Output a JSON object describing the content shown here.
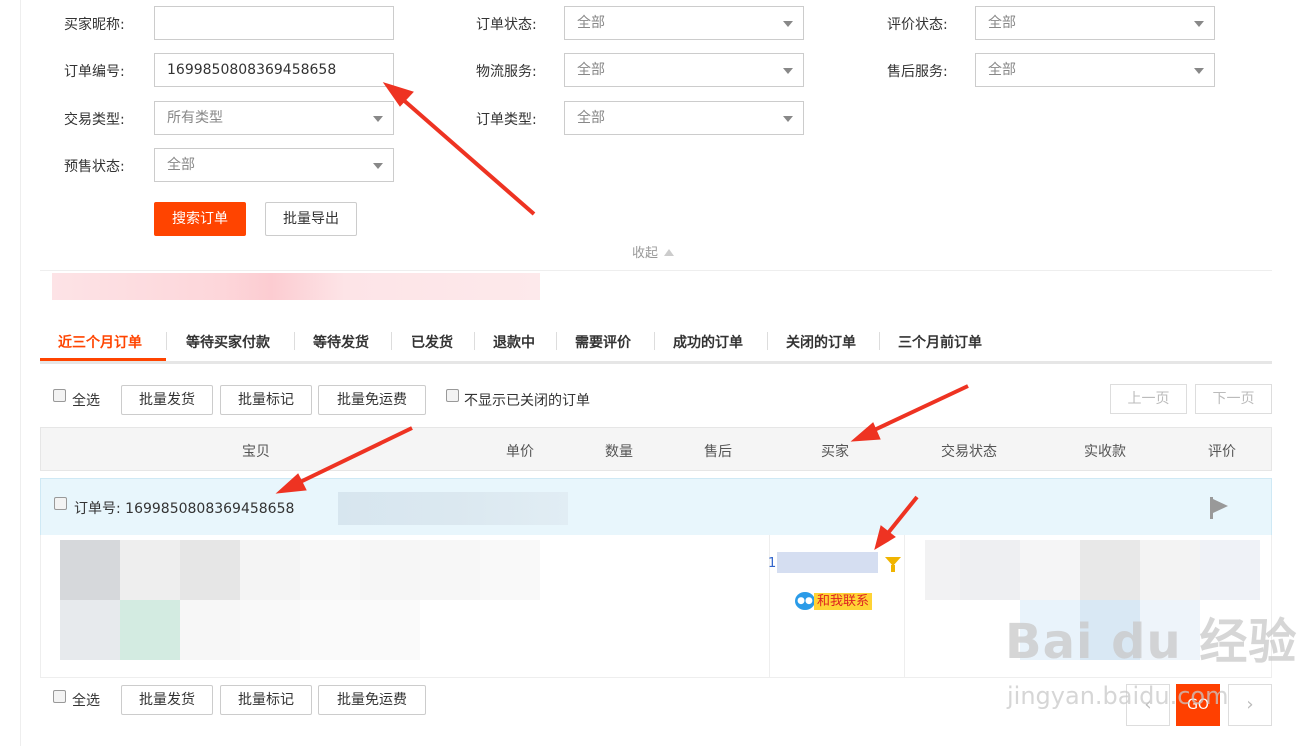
{
  "search_form": {
    "buyer_nickname": {
      "label": "买家昵称:",
      "value": ""
    },
    "order_number": {
      "label": "订单编号:",
      "value": "1699850808369458658"
    },
    "trade_type": {
      "label": "交易类型:",
      "value": "所有类型"
    },
    "presale_status": {
      "label": "预售状态:",
      "value": "全部"
    },
    "order_status": {
      "label": "订单状态:",
      "value": "全部"
    },
    "logistics_service": {
      "label": "物流服务:",
      "value": "全部"
    },
    "order_type": {
      "label": "订单类型:",
      "value": "全部"
    },
    "review_status": {
      "label": "评价状态:",
      "value": "全部"
    },
    "aftersale_service": {
      "label": "售后服务:",
      "value": "全部"
    },
    "search_button": "搜索订单",
    "export_button": "批量导出",
    "collapse_label": "收起"
  },
  "tabs": [
    "近三个月订单",
    "等待买家付款",
    "等待发货",
    "已发货",
    "退款中",
    "需要评价",
    "成功的订单",
    "关闭的订单",
    "三个月前订单"
  ],
  "active_tab": "近三个月订单",
  "toolbar": {
    "select_all": "全选",
    "batch_ship": "批量发货",
    "batch_mark": "批量标记",
    "batch_free_shipping": "批量免运费",
    "hide_closed": "不显示已关闭的订单",
    "prev_page": "上一页",
    "next_page": "下一页"
  },
  "table_headers": {
    "item": "宝贝",
    "unit_price": "单价",
    "quantity": "数量",
    "aftersale": "售后",
    "buyer": "买家",
    "trade_status": "交易状态",
    "paid_amount": "实收款",
    "review": "评价"
  },
  "order": {
    "order_number_label": "订单号: 1699850808369458658",
    "buyer_prefix": "1",
    "contact_label": "和我联系"
  },
  "footer": {
    "select_all": "全选",
    "batch_ship": "批量发货",
    "batch_mark": "批量标记",
    "batch_free_shipping": "批量免运费",
    "go_button": "GO"
  },
  "watermark": {
    "logo": "Bai du 经验",
    "url": "jingyan.baidu.com"
  },
  "colors": {
    "accent": "#ff4400",
    "annotation_arrow": "#ee3322",
    "order_header_bg": "#e8f6fc"
  }
}
